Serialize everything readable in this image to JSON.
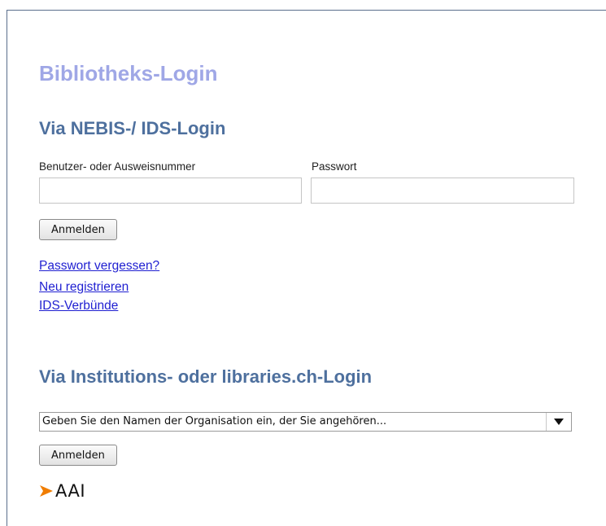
{
  "page": {
    "title": "Bibliotheks-Login"
  },
  "nebis_section": {
    "title": "Via NEBIS-/ IDS-Login",
    "username_label": "Benutzer- oder Ausweisnummer",
    "username_value": "",
    "password_label": "Passwort",
    "password_value": "",
    "login_button": "Anmelden",
    "links": {
      "forgot_password": "Passwort vergessen?",
      "register": "Neu registrieren",
      "ids_networks": "IDS-Verbünde"
    }
  },
  "institution_section": {
    "title": "Via Institutions- oder libraries.ch-Login",
    "organisation_select_value": "Geben Sie den Namen der Organisation ein, der Sie angehören...",
    "login_button": "Anmelden",
    "logo_text": "AAI"
  },
  "colors": {
    "page_title": "#9fa7e6",
    "section_title": "#4e709e",
    "link": "#1f1fd1",
    "logo_chevron": "#f07d00"
  },
  "icons": {
    "dropdown": "triangle-down-icon",
    "logo_mark": "chevron-right-icon"
  }
}
